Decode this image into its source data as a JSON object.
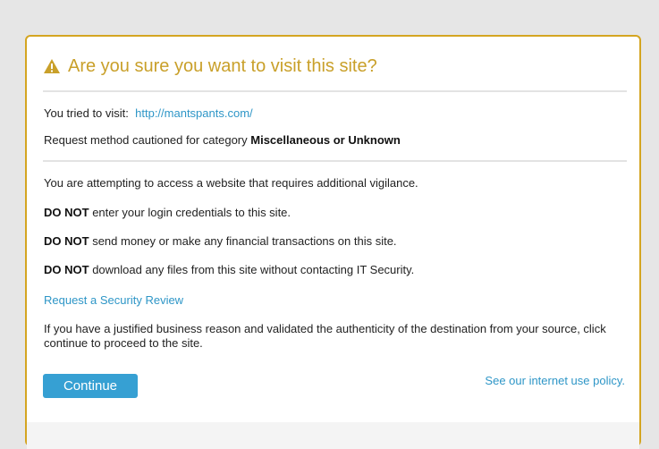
{
  "dialog": {
    "title": "Are you sure you want to visit this site?",
    "visit_prefix": "You tried to visit:",
    "visit_url": "http://mantspants.com/",
    "category_prefix": "Request method cautioned for category",
    "category_name": "Miscellaneous or Unknown",
    "vigilance_text": "You are attempting to access a website that requires additional vigilance.",
    "warnings": [
      {
        "emphasis": "DO NOT",
        "text": "enter your login credentials to this site."
      },
      {
        "emphasis": "DO NOT",
        "text": "send money or make any financial transactions on this site."
      },
      {
        "emphasis": "DO NOT",
        "text": "download any files from this site without contacting IT Security."
      }
    ],
    "review_link": "Request a Security Review",
    "justification_text": "If you have a justified business reason and validated the authenticity of the destination from your source, click continue to proceed to the site.",
    "continue_label": "Continue",
    "policy_link": "See our internet use policy."
  },
  "colors": {
    "accent": "#d4a521",
    "title": "#c9a02a",
    "link": "#2e96c7",
    "button": "#36a0d3"
  },
  "icons": {
    "header": "warning-triangle-icon"
  }
}
